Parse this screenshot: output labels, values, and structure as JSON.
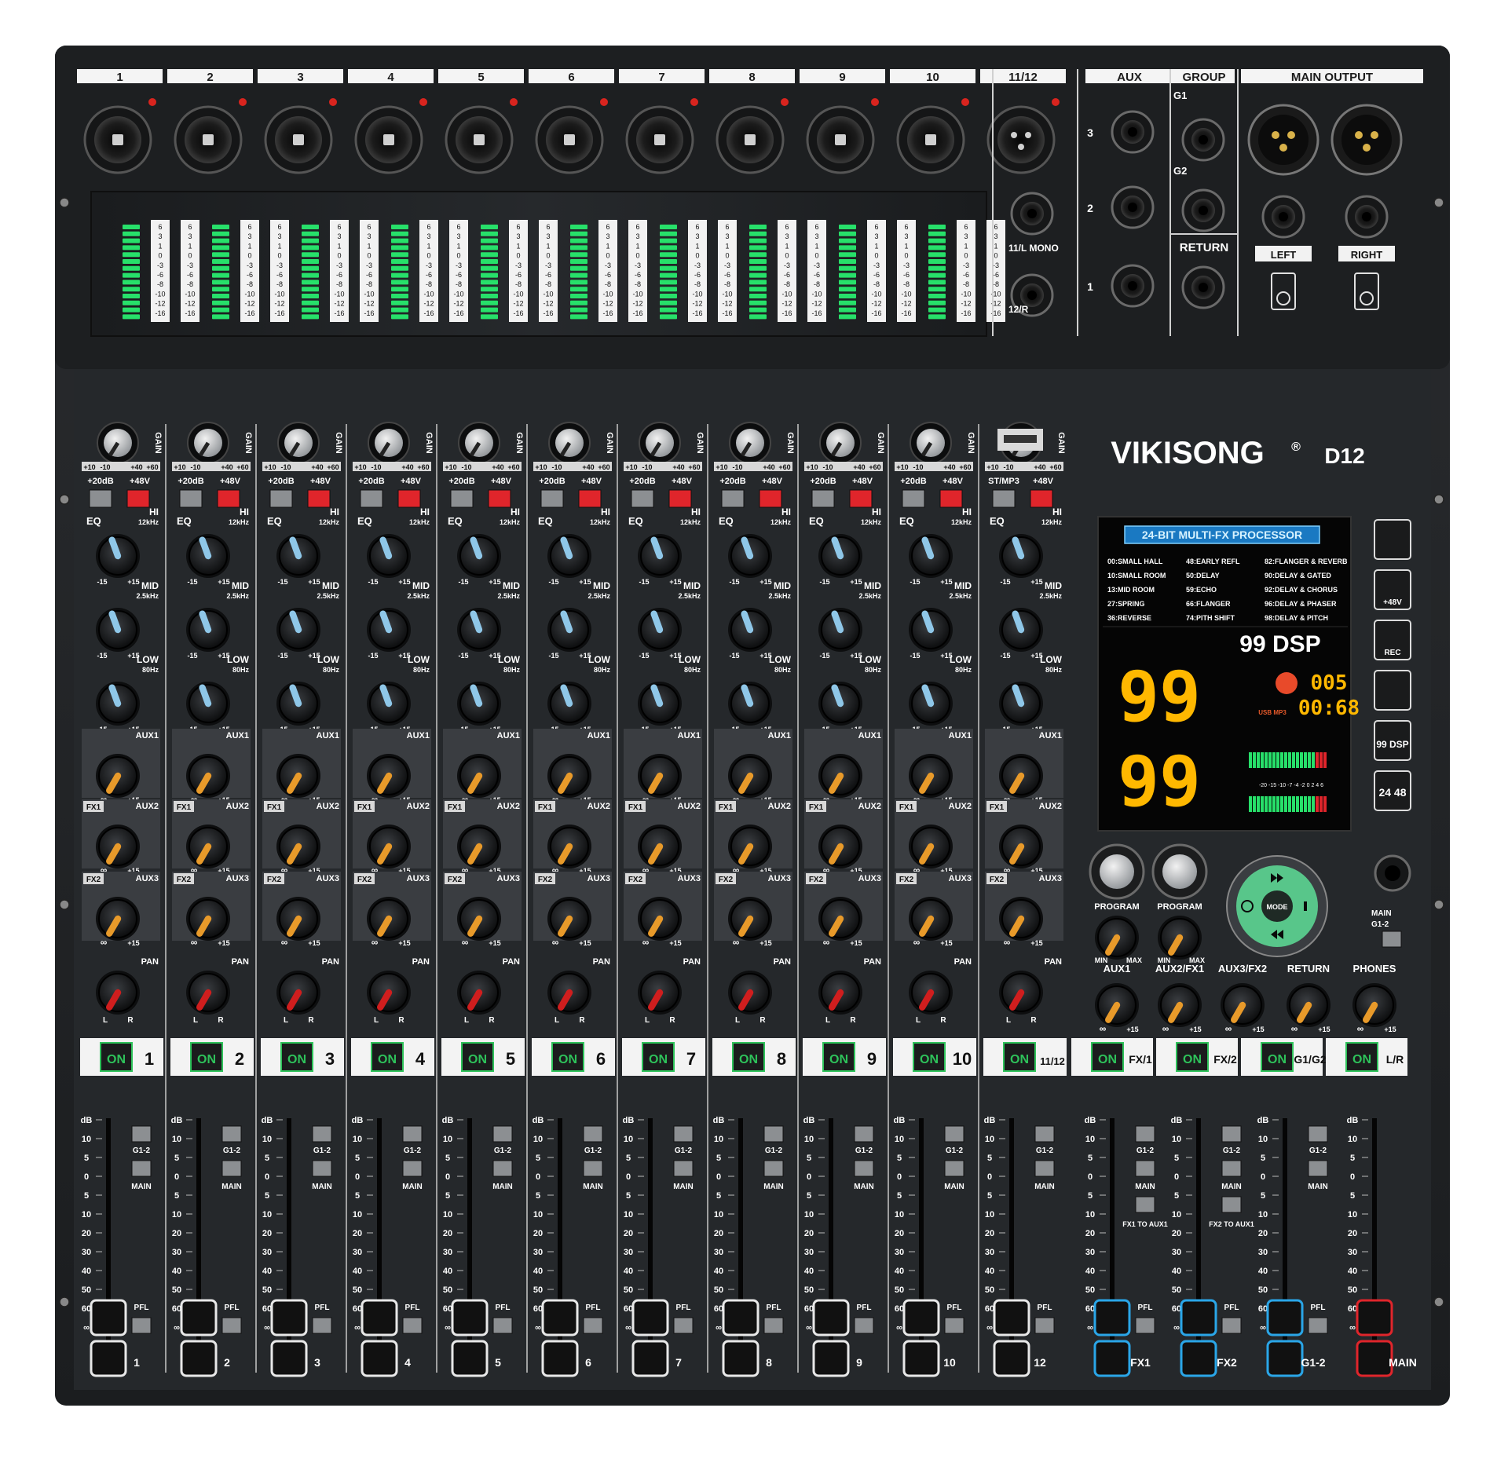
{
  "top_channels": [
    "1",
    "2",
    "3",
    "4",
    "5",
    "6",
    "7",
    "8",
    "9",
    "10",
    "11/12"
  ],
  "top_sections": {
    "aux": "AUX",
    "group": "GROUP",
    "main_output": "MAIN OUTPUT"
  },
  "meter_scale": [
    "6",
    "3",
    "1",
    "0",
    "-3",
    "-6",
    "-8",
    "-10",
    "-12",
    "-16"
  ],
  "jack_labels": {
    "mono_l": "11/L MONO",
    "mono_r": "12/R",
    "aux_nums": [
      "3",
      "2",
      "1"
    ],
    "g1": "G1",
    "g2": "G2",
    "return": "RETURN",
    "left": "LEFT",
    "right": "RIGHT"
  },
  "gain": {
    "label": "GAIN",
    "scale_low": "+10",
    "scale_mid1": "-10",
    "scale_mid2": "+40",
    "scale_high": "+60"
  },
  "switches": {
    "pad": "+20dB",
    "phantom": "+48V",
    "stmp3": "ST/MP3"
  },
  "eq": {
    "eq": "EQ",
    "hi": "HI",
    "hi_freq": "12kHz",
    "mid": "MID",
    "mid_freq": "2.5kHz",
    "low": "LOW",
    "low_freq": "80Hz",
    "min": "-15",
    "max": "+15"
  },
  "sends": {
    "aux1": "AUX1",
    "aux2": "AUX2",
    "aux3": "AUX3",
    "fx1": "FX1",
    "fx2": "FX2",
    "inf": "∞",
    "plus": "+15"
  },
  "pan": {
    "label": "PAN",
    "l": "L",
    "r": "R"
  },
  "on_label": "ON",
  "strip_numbers": [
    "1",
    "2",
    "3",
    "4",
    "5",
    "6",
    "7",
    "8",
    "9",
    "10",
    "11/12"
  ],
  "master_on": [
    "FX/1",
    "FX/2",
    "G1/G2",
    "L/R"
  ],
  "brand": {
    "name": "VIKISONG",
    "reg": "®",
    "model": "D12",
    "usb": "USB"
  },
  "fx_display": {
    "header": "24-BIT MULTI-FX PROCESSOR",
    "presets": [
      "00:SMALL HALL",
      "48:EARLY REFL",
      "82:FLANGER & REVERB",
      "10:SMALL ROOM",
      "50:DELAY",
      "90:DELAY & GATED",
      "13:MID ROOM",
      "59:ECHO",
      "92:DELAY & CHORUS",
      "27:SPRING",
      "66:FLANGER",
      "96:DELAY & PHASER",
      "36:REVERSE",
      "74:PITH SHIFT",
      "98:DELAY & PITCH"
    ],
    "dsp": "99 DSP",
    "num1": "99",
    "num2": "99",
    "track": "005",
    "time": "00:68",
    "usb_mp3": "USB MP3",
    "meter_scale": "-20 -15 -10 -7 -4 -2 0 2 4 6"
  },
  "side_icons": [
    "headphone-icon",
    "phantom-icon",
    "rec-icon",
    "usb-icon",
    "dsp99-icon",
    "bitrate-icon"
  ],
  "side_labels": {
    "p48": "+48V",
    "rec": "REC",
    "dsp": "99 DSP",
    "bit": "24 48"
  },
  "master": {
    "program": "PROGRAM",
    "min": "MIN",
    "max": "MAX",
    "mode": "MODE",
    "aux1": "AUX1",
    "aux2fx1": "AUX2/FX1",
    "aux3fx2": "AUX3/FX2",
    "return": "RETURN",
    "phones": "PHONES",
    "main_sw": "MAIN",
    "g12_sw": "G1-2"
  },
  "fader_scale": [
    "dB",
    "10",
    "5",
    "0",
    "5",
    "10",
    "20",
    "30",
    "40",
    "50",
    "60",
    "∞"
  ],
  "fader_assign": {
    "g12": "G1-2",
    "main": "MAIN",
    "pfl": "PFL",
    "fx1aux1": "FX1 TO AUX1",
    "fx2aux1": "FX2 TO AUX1"
  },
  "fader_bottom": [
    "1",
    "2",
    "3",
    "4",
    "5",
    "6",
    "7",
    "8",
    "9",
    "10",
    "12",
    "FX1",
    "FX2",
    "G1-2",
    "MAIN"
  ],
  "colors": {
    "chassis": "#1e2022",
    "panel": "#2a2d30",
    "gain_cap": "#bfc3c6",
    "eq_pointer": "#8fc7e8",
    "send_pointer": "#e89a2a",
    "pan_pointer": "#d01e1e",
    "led_green": "#27e06a",
    "seg_yellow": "#ffb800",
    "switch_red": "#e0252b",
    "fader_blue": "#2aa6e8",
    "fader_red": "#e0252b",
    "on_green": "#2ec25a"
  }
}
